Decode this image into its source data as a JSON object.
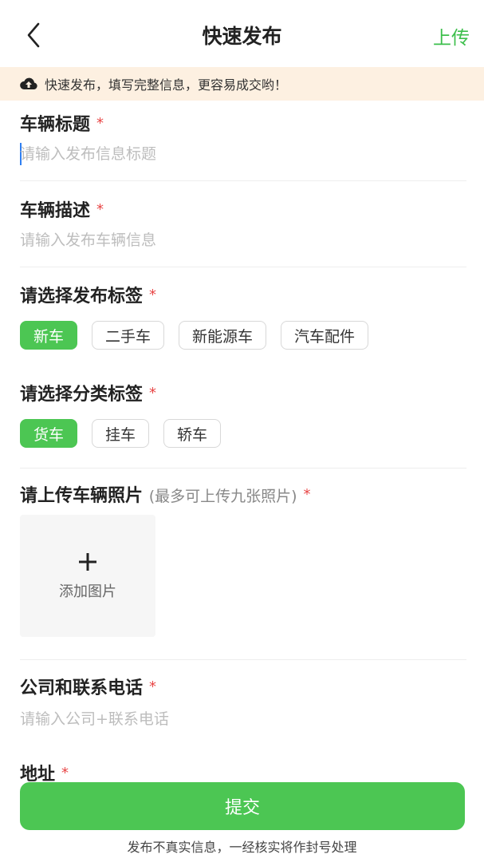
{
  "header": {
    "title": "快速发布",
    "upload_label": "上传"
  },
  "notice": {
    "text": "快速发布，填写完整信息，更容易成交哟！"
  },
  "vehicle_title": {
    "label": "车辆标题",
    "required_mark": "*",
    "placeholder": "请输入发布信息标题",
    "value": ""
  },
  "vehicle_desc": {
    "label": "车辆描述",
    "required_mark": "*",
    "placeholder": "请输入发布车辆信息",
    "value": ""
  },
  "publish_tags": {
    "label": "请选择发布标签",
    "required_mark": "*",
    "items": [
      "新车",
      "二手车",
      "新能源车",
      "汽车配件"
    ],
    "selected": "新车"
  },
  "category_tags": {
    "label": "请选择分类标签",
    "required_mark": "*",
    "items": [
      "货车",
      "挂车",
      "轿车"
    ],
    "selected": "货车"
  },
  "photos": {
    "label": "请上传车辆照片",
    "hint": "(最多可上传九张照片)",
    "required_mark": "*",
    "add_label": "添加图片"
  },
  "contact": {
    "label": "公司和联系电话",
    "required_mark": "*",
    "placeholder": "请输入公司+联系电话",
    "value": ""
  },
  "address": {
    "label": "地址",
    "required_mark": "*"
  },
  "submit": {
    "label": "提交"
  },
  "footer": {
    "note": "发布不真实信息，一经核实将作封号处理"
  },
  "colors": {
    "accent": "#4cc653",
    "notice_bg": "#fdf0e1",
    "required": "#e84545"
  }
}
